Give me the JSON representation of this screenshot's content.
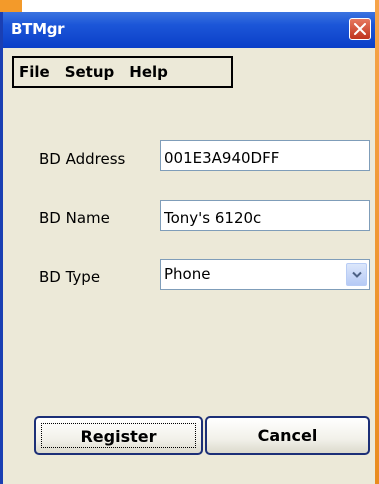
{
  "window": {
    "title": "BTMgr",
    "colors": {
      "titlebar": "#1c56d8",
      "close_button": "#d8543a",
      "background": "#ece9d8",
      "accent": "#f39a2a"
    }
  },
  "menu": {
    "items": [
      "File",
      "Setup",
      "Help"
    ]
  },
  "form": {
    "bd_address": {
      "label": "BD Address",
      "value": "001E3A940DFF"
    },
    "bd_name": {
      "label": "BD Name",
      "value": "Tony's 6120c"
    },
    "bd_type": {
      "label": "BD Type",
      "value": "Phone"
    }
  },
  "buttons": {
    "register": "Register",
    "cancel": "Cancel"
  },
  "icons": {
    "close": "close-icon",
    "dropdown": "chevron-down-icon"
  }
}
